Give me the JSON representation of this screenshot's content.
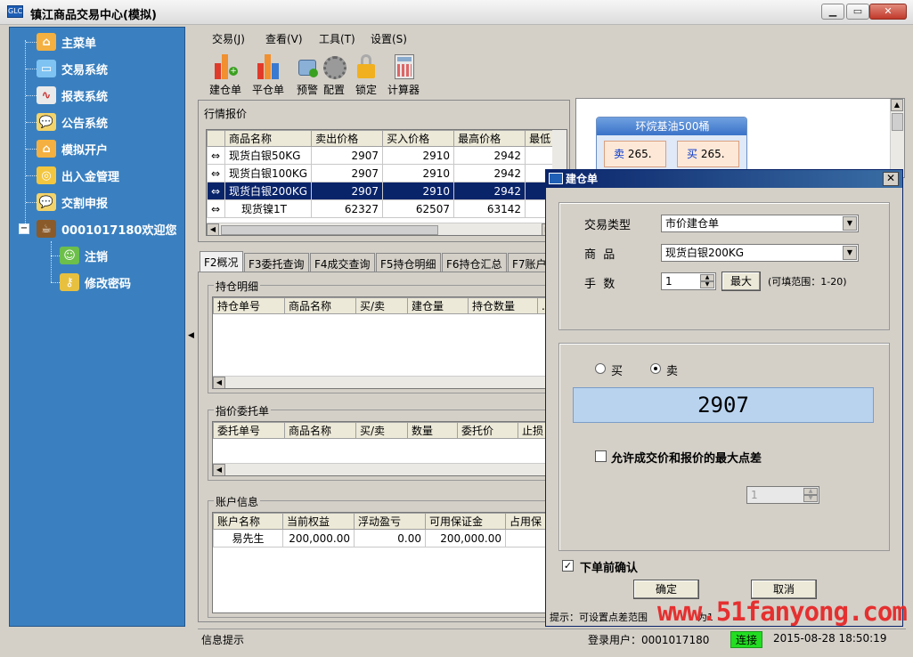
{
  "window": {
    "title": "镇江商品交易中心(模拟)",
    "icon_text": "GLC"
  },
  "sidebar": {
    "items": [
      {
        "label": "主菜单",
        "icon": "home-icon"
      },
      {
        "label": "交易系统",
        "icon": "monitor-icon"
      },
      {
        "label": "报表系统",
        "icon": "chart-icon"
      },
      {
        "label": "公告系统",
        "icon": "chat-icon"
      },
      {
        "label": "模拟开户",
        "icon": "home-icon"
      },
      {
        "label": "出入金管理",
        "icon": "coins-icon"
      },
      {
        "label": "交割申报",
        "icon": "chat-icon"
      }
    ],
    "user": {
      "label": "0001017180欢迎您",
      "expand": "−",
      "children": [
        {
          "label": "注销",
          "icon": "user-icon"
        },
        {
          "label": "修改密码",
          "icon": "key-icon"
        }
      ]
    }
  },
  "menubar": [
    "交易(J)",
    "查看(V)",
    "工具(T)",
    "设置(S)"
  ],
  "toolbar": [
    {
      "label": "建仓单"
    },
    {
      "label": "平仓单"
    },
    {
      "label": "预警"
    },
    {
      "label": "配置"
    },
    {
      "label": "锁定"
    },
    {
      "label": "计算器"
    }
  ],
  "quotes": {
    "title": "行情报价",
    "columns": [
      "商品名称",
      "卖出价格",
      "买入价格",
      "最高价格",
      "最低"
    ],
    "rows": [
      [
        "现货白银50KG",
        "2907",
        "2910",
        "2942"
      ],
      [
        "现货白银100KG",
        "2907",
        "2910",
        "2942"
      ],
      [
        "现货白银200KG",
        "2907",
        "2910",
        "2942"
      ],
      [
        "现货镍1T",
        "62327",
        "62507",
        "63142"
      ]
    ],
    "selected_row": 2
  },
  "tabs": [
    "F2概况",
    "F3委托查询",
    "F4成交查询",
    "F5持仓明细",
    "F6持仓汇总",
    "F7账户"
  ],
  "positions": {
    "title": "持仓明细",
    "columns": [
      "持仓单号",
      "商品名称",
      "买/卖",
      "建仓量",
      "持仓数量",
      "..."
    ]
  },
  "orders": {
    "title": "指价委托单",
    "columns": [
      "委托单号",
      "商品名称",
      "买/卖",
      "数量",
      "委托价",
      "止损"
    ]
  },
  "account": {
    "title": "账户信息",
    "columns": [
      "账户名称",
      "当前权益",
      "浮动盈亏",
      "可用保证金",
      "占用保"
    ],
    "row": [
      "易先生",
      "200,000.00",
      "0.00",
      "200,000.00",
      ""
    ]
  },
  "contract": {
    "title": "环烷基油500桶",
    "sell_word": "卖",
    "sell_value": "265.",
    "buy_word": "买",
    "buy_value": "265."
  },
  "dialog": {
    "title": "建仓单",
    "trade_type_label": "交易类型",
    "trade_type_value": "市价建仓单",
    "product_label": "商  品",
    "product_value": "现货白银200KG",
    "qty_label": "手  数",
    "qty_value": "1",
    "max_button": "最大",
    "qty_range": "(可填范围：1-20)",
    "buy_label": "买",
    "sell_label": "卖",
    "price": "2907",
    "allow_diff_label": "允许成交价和报价的最大点差",
    "diff_value": "1",
    "confirm_label": "下单前确认",
    "ok_button": "确定",
    "cancel_button": "取消",
    "hint": "提示：可设置点差范围",
    "hint_tail": "为1"
  },
  "status": {
    "info": "信息提示",
    "login": "登录用户：0001017180",
    "connection": "连接",
    "datetime": "2015-08-28 18:50:19"
  },
  "watermark": "www.51fanyong.com",
  "colors": {
    "sidebar": "#3a80c0",
    "selected_row": "#0a246a",
    "price_display": "#b9d3ef",
    "connected": "#22dd22",
    "watermark": "#e53030"
  }
}
